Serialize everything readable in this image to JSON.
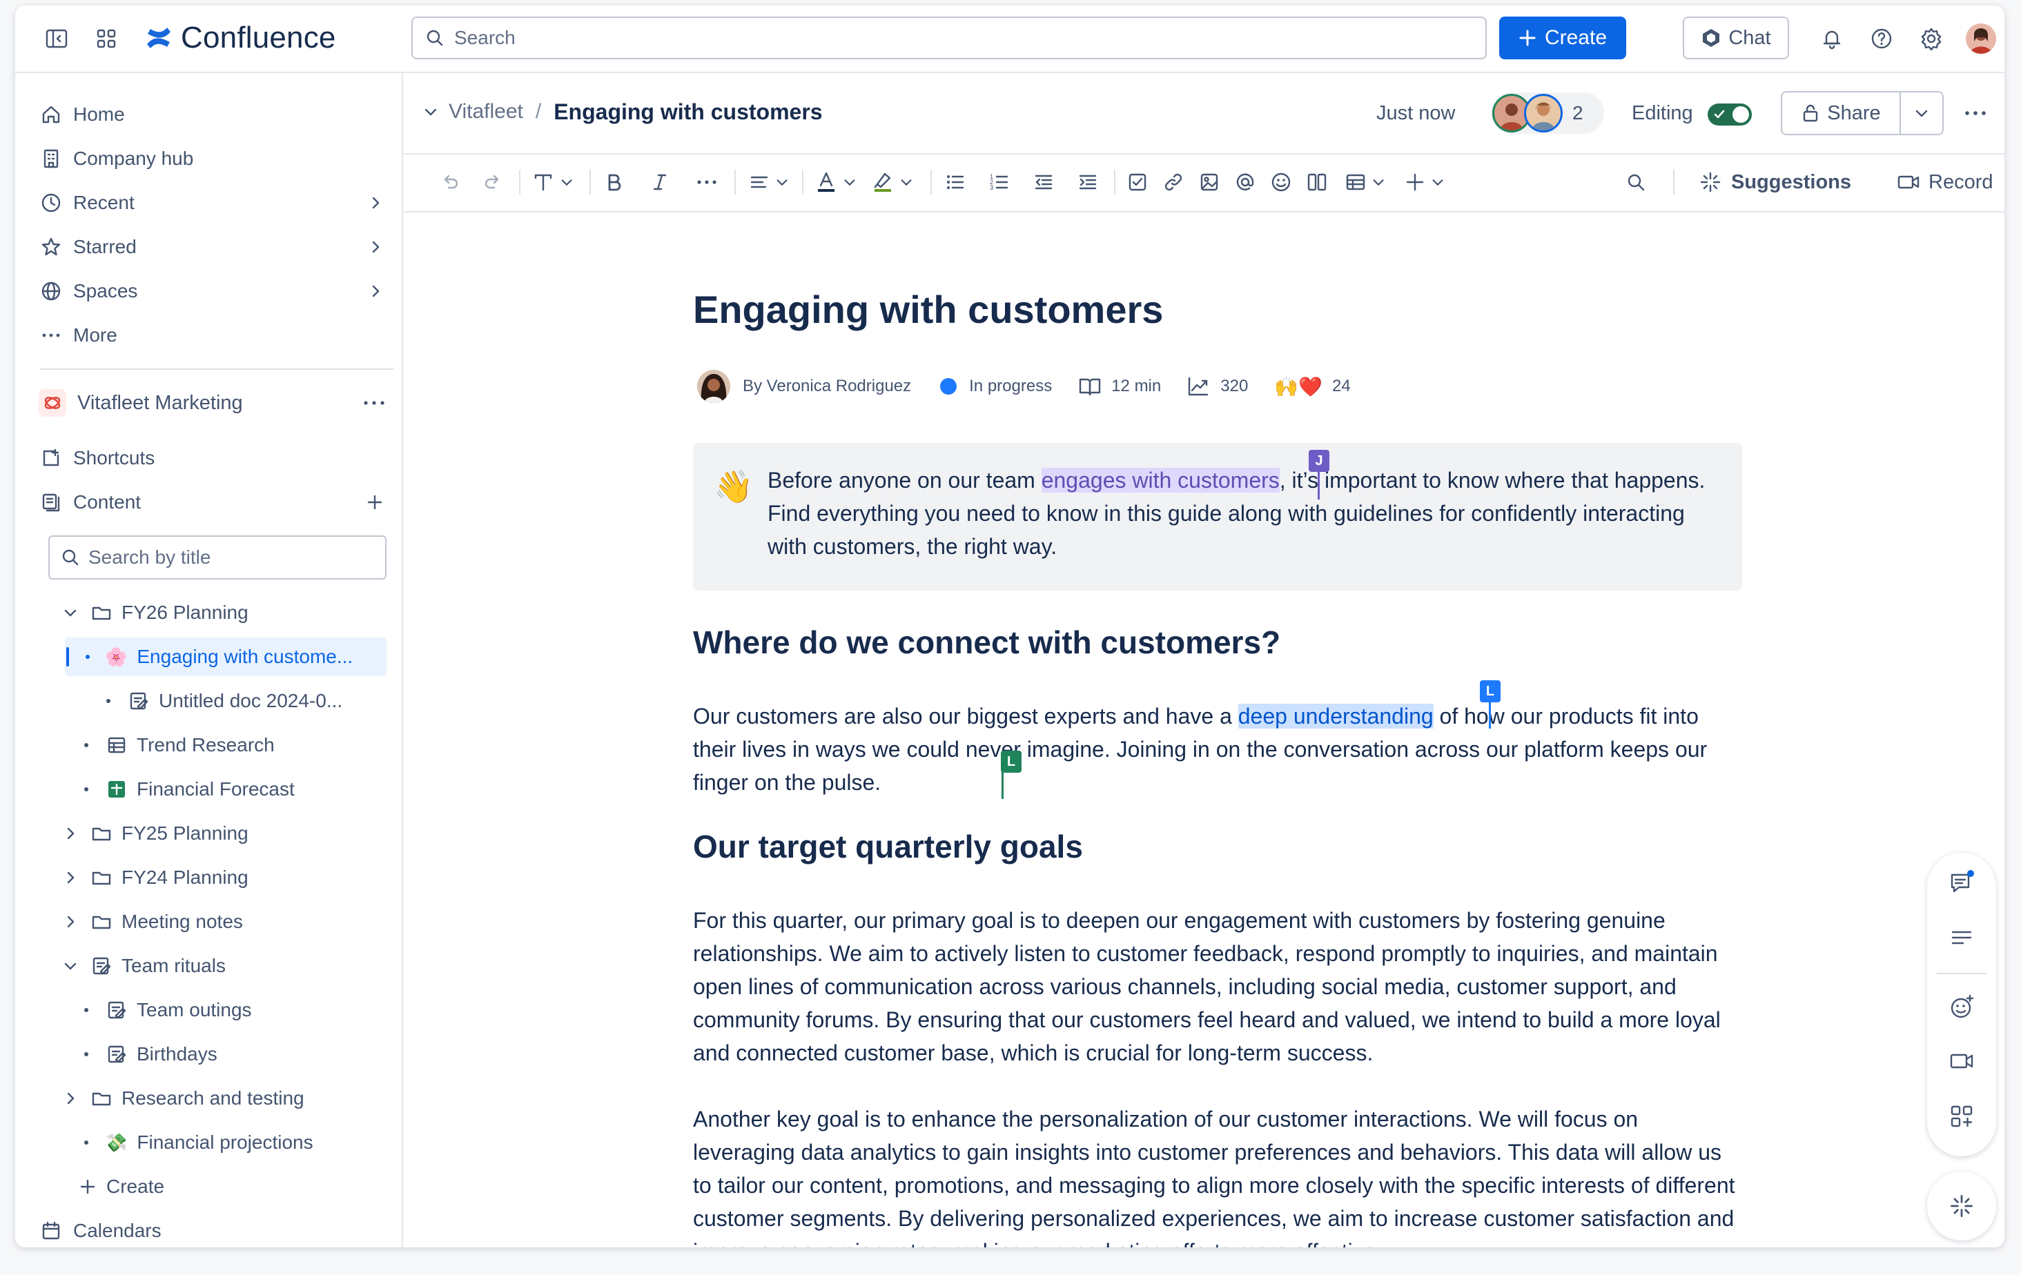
{
  "app": {
    "name": "Confluence"
  },
  "topbar": {
    "search_placeholder": "Search",
    "create_label": "Create",
    "chat_label": "Chat"
  },
  "sidebar": {
    "nav": [
      {
        "label": "Home",
        "icon": "home-icon"
      },
      {
        "label": "Company hub",
        "icon": "building-icon"
      },
      {
        "label": "Recent",
        "icon": "clock-icon"
      },
      {
        "label": "Starred",
        "icon": "star-icon"
      },
      {
        "label": "Spaces",
        "icon": "globe-icon"
      },
      {
        "label": "More",
        "icon": "more-icon"
      }
    ],
    "space_name": "Vitafleet Marketing",
    "shortcuts_label": "Shortcuts",
    "content_label": "Content",
    "tree_search_placeholder": "Search by title",
    "tree": [
      {
        "label": "FY26 Planning",
        "icon": "folder-icon"
      },
      {
        "label": "Engaging with custome...",
        "icon": "flower-emoji-icon"
      },
      {
        "label": "Untitled doc 2024-0...",
        "icon": "live-doc-icon"
      },
      {
        "label": "Trend Research",
        "icon": "database-icon"
      },
      {
        "label": "Financial Forecast",
        "icon": "spreadsheet-icon"
      },
      {
        "label": "FY25 Planning",
        "icon": "folder-icon"
      },
      {
        "label": "FY24 Planning",
        "icon": "folder-icon"
      },
      {
        "label": "Meeting notes",
        "icon": "folder-icon"
      },
      {
        "label": "Team rituals",
        "icon": "live-doc-icon"
      },
      {
        "label": "Team outings",
        "icon": "live-doc-icon"
      },
      {
        "label": "Birthdays",
        "icon": "live-doc-icon"
      },
      {
        "label": "Research and testing",
        "icon": "folder-icon"
      },
      {
        "label": "Financial projections",
        "icon": "money-emoji-icon"
      }
    ],
    "create_label": "Create",
    "calendars_label": "Calendars"
  },
  "pagehead": {
    "breadcrumb_space": "Vitafleet",
    "breadcrumb_page": "Engaging with customers",
    "saved_status": "Just now",
    "collaborator_count": "2",
    "editing_label": "Editing",
    "share_label": "Share"
  },
  "toolbar": {
    "suggestions_label": "Suggestions",
    "record_label": "Record"
  },
  "doc": {
    "title": "Engaging with customers",
    "meta": {
      "author": "By Veronica Rodriguez",
      "status": "In progress",
      "read_time": "12 min",
      "views": "320",
      "reactions": "24"
    },
    "panel": {
      "text_before": "Before anyone on our team ",
      "highlight": "engages with customers",
      "text_after": ", it’s important to know where that happens. Find everything you need to know in this guide along with guidelines for confidently interacting with customers, the right way.",
      "cursor_initial": "J"
    },
    "h2_connect": "Where do we connect with customers?",
    "p_connect": {
      "before": "Our customers are also our biggest experts and have a ",
      "highlight": "deep understanding",
      "after": " of how our products fit into their lives in ways we could never imagine. Joining in on the conversation across our platform keeps our finger on the pulse.",
      "cursor_blue": "L",
      "cursor_green": "L"
    },
    "h2_goals": "Our target quarterly goals",
    "p_goals_1": "For this quarter, our primary goal is to deepen our engagement with customers by fostering genuine relationships. We aim to actively listen to customer feedback, respond promptly to inquiries, and maintain open lines of communication across various channels, including social media, customer support, and community forums. By ensuring that our customers feel heard and valued, we intend to build a more loyal and connected customer base, which is crucial for long-term success.",
    "p_goals_2": "Another key goal is to enhance the personalization of our customer interactions. We will focus on leveraging data analytics to gain insights into customer preferences and behaviors. This data will allow us to tailor our content, promotions, and messaging to align more closely with the specific interests of different customer segments. By delivering personalized experiences, we aim to increase customer satisfaction and improve conversion rates, making our marketing efforts more effective."
  },
  "colors": {
    "brand_blue": "#0c66e4",
    "text_primary": "#172b4d",
    "text_subtle": "#44546f",
    "toggle_green": "#216e4e",
    "purple_highlight": "#dfd8fd",
    "blue_highlight": "#cce0ff"
  }
}
